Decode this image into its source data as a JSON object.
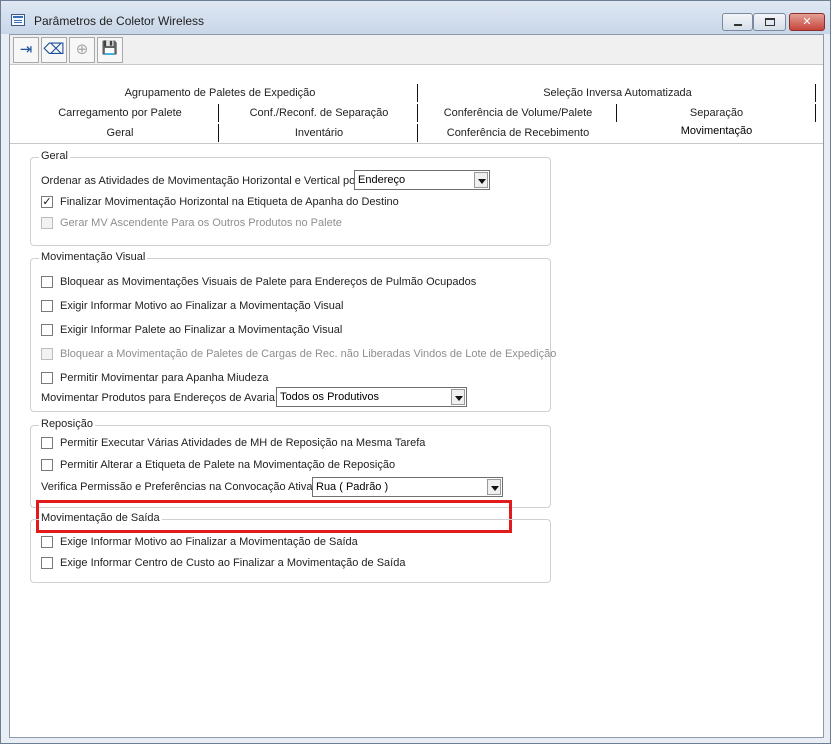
{
  "window": {
    "title": "Parâmetros de Coletor Wireless",
    "controls": {
      "minimize": "",
      "maximize": "",
      "close": "✕"
    }
  },
  "toolbar": {
    "buttons": [
      {
        "icon": "exit-icon",
        "glyph": "⇥",
        "enabled": true
      },
      {
        "icon": "eraser-icon",
        "glyph": "⌫",
        "enabled": true
      },
      {
        "icon": "add-circle-icon",
        "glyph": "⊕",
        "enabled": false
      },
      {
        "icon": "save-icon",
        "glyph": "💾",
        "enabled": true
      }
    ]
  },
  "tabs": {
    "row1": [
      "Agrupamento de Paletes de Expedição",
      "Seleção Inversa Automatizada"
    ],
    "row2": [
      "Carregamento por Palete",
      "Conf./Reconf. de Separação",
      "Conferência de Volume/Palete",
      "Separação"
    ],
    "row3": [
      "Geral",
      "Inventário",
      "Conferência de Recebimento",
      "Movimentação"
    ],
    "active": "Movimentação"
  },
  "groups": {
    "geral": {
      "title": "Geral",
      "order_label": "Ordenar as Atividades de Movimentação Horizontal e Vertical por",
      "order_value": "Endereço",
      "finalize_label": "Finalizar Movimentação Horizontal na Etiqueta de Apanha do Destino",
      "finalize_checked": true,
      "gerar_label": "Gerar MV Ascendente Para os Outros Produtos no Palete",
      "gerar_enabled": false
    },
    "visual": {
      "title": "Movimentação Visual",
      "items": [
        {
          "label": "Bloquear as Movimentações Visuais de Palete para Endereços de Pulmão Ocupados",
          "enabled": true
        },
        {
          "label": "Exigir Informar Motivo ao Finalizar a Movimentação Visual",
          "enabled": true
        },
        {
          "label": "Exigir Informar Palete ao Finalizar a Movimentação Visual",
          "enabled": true
        },
        {
          "label": "Bloquear a Movimentação de Paletes de Cargas de Rec. não Liberadas Vindos de Lote de Expedição",
          "enabled": false
        },
        {
          "label": "Permitir Movimentar para Apanha Miudeza",
          "enabled": true
        }
      ],
      "avaria_label": "Movimentar Produtos para Endereços de Avaria",
      "avaria_value": "Todos os Produtivos"
    },
    "reposicao": {
      "title": "Reposição",
      "items": [
        {
          "label": "Permitir Executar Várias Atividades de MH de Reposição na Mesma Tarefa"
        },
        {
          "label": "Permitir Alterar a Etiqueta de Palete na Movimentação de Reposição"
        }
      ],
      "verifica_label": "Verifica Permissão e Preferências na Convocação Ativa",
      "verifica_value": "Rua ( Padrão )"
    },
    "saida": {
      "title": "Movimentação de Saída",
      "items": [
        {
          "label": "Exige Informar Motivo ao Finalizar a Movimentação de Saída"
        },
        {
          "label": "Exige Informar Centro de Custo ao Finalizar a Movimentação de Saída"
        }
      ]
    }
  },
  "colors": {
    "highlight": "#e11b1b",
    "window_border": "#6d7e93"
  }
}
